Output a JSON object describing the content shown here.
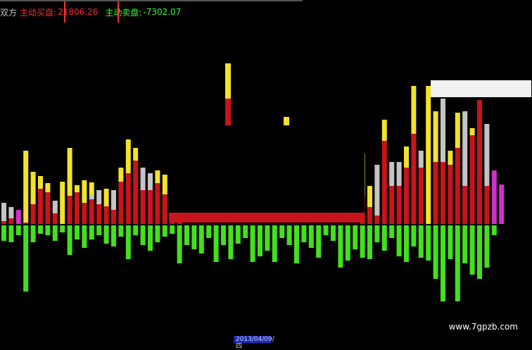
{
  "header": {
    "left_label": "双方",
    "buy_label": "主动买盘:",
    "buy_value": "21806.26",
    "sell_label": "主动卖盘:",
    "sell_value": "-7302.07"
  },
  "watermark": "www.7gpzb.com",
  "date_tag": "2013/04/09/四",
  "colors": {
    "red": "#c8141a",
    "yellow": "#f2e22b",
    "gray": "#c4c4c4",
    "green": "#43e01c",
    "magenta": "#d030c8"
  },
  "chart_data": {
    "type": "bar",
    "baseline": 0,
    "up_bars": [
      {
        "red": 4,
        "yellow": 0,
        "gray": 26
      },
      {
        "red": 8,
        "yellow": 0,
        "gray": 16
      },
      {
        "red": 0,
        "yellow": 0,
        "gray": 0,
        "magenta": 20
      },
      {
        "red": 2,
        "yellow": 102
      },
      {
        "red": 28,
        "yellow": 46
      },
      {
        "red": 50,
        "yellow": 18
      },
      {
        "red": 45,
        "yellow": 13
      },
      {
        "red": 15,
        "yellow": 0,
        "gray": 18
      },
      {
        "red": 0,
        "yellow": 60
      },
      {
        "red": 40,
        "yellow": 68
      },
      {
        "red": 45,
        "yellow": 10
      },
      {
        "red": 30,
        "yellow": 32
      },
      {
        "red": 35,
        "yellow": 18,
        "gray": 6
      },
      {
        "red": 28,
        "yellow": 0,
        "gray": 20
      },
      {
        "red": 25,
        "yellow": 25
      },
      {
        "red": 20,
        "yellow": 0,
        "gray": 28
      },
      {
        "red": 60,
        "yellow": 20,
        "gray": 0
      },
      {
        "red": 72,
        "yellow": 48
      },
      {
        "red": 90,
        "yellow": 18
      },
      {
        "red": 48,
        "yellow": 0,
        "gray": 32
      },
      {
        "red": 48,
        "yellow": 0,
        "gray": 24
      },
      {
        "red": 58,
        "yellow": 18
      },
      {
        "red": 42,
        "yellow": 28
      },
      {
        "red": 90,
        "yellow": 40
      },
      {
        "red": 90,
        "yellow": 40
      },
      {
        "red": 0,
        "yellow": 0
      },
      {
        "red": 0,
        "yellow": 0
      },
      {
        "red": 0,
        "yellow": 0
      },
      {
        "red": 0,
        "yellow": 0
      },
      {
        "red": 0,
        "yellow": 0
      },
      {
        "red": 0,
        "yellow": 0
      },
      {
        "red": 0,
        "yellow": 0
      },
      {
        "red": 0,
        "yellow": 0
      },
      {
        "red": 0,
        "yellow": 0
      },
      {
        "red": 0,
        "yellow": 0
      },
      {
        "red": 0,
        "yellow": 0
      },
      {
        "red": 0,
        "yellow": 0
      },
      {
        "red": 0,
        "yellow": 0
      },
      {
        "red": 0,
        "yellow": 0
      },
      {
        "red": 0,
        "yellow": 0
      },
      {
        "red": 0,
        "yellow": 0
      },
      {
        "red": 0,
        "yellow": 0
      },
      {
        "red": 0,
        "yellow": 0
      },
      {
        "red": 0,
        "yellow": 0
      },
      {
        "red": 0,
        "yellow": 0
      },
      {
        "red": 0,
        "yellow": 0
      },
      {
        "red": 0,
        "yellow": 0
      },
      {
        "red": 0,
        "yellow": 0
      },
      {
        "red": 0,
        "yellow": 0
      },
      {
        "red": 40,
        "yellow": 60
      },
      {
        "red": 24,
        "yellow": 30
      },
      {
        "red": 12,
        "yellow": 0,
        "gray": 72
      },
      {
        "red": 118,
        "yellow": 30
      },
      {
        "red": 54,
        "yellow": 0,
        "gray": 34
      },
      {
        "red": 54,
        "yellow": 0,
        "gray": 34
      },
      {
        "red": 80,
        "yellow": 30
      },
      {
        "red": 128,
        "yellow": 68
      },
      {
        "red": 80,
        "yellow": 0,
        "gray": 24
      },
      {
        "red": 0,
        "yellow": 196
      },
      {
        "red": 88,
        "yellow": 72
      },
      {
        "red": 88,
        "yellow": 0,
        "gray": 90
      },
      {
        "red": 84,
        "yellow": 20,
        "gray": 0
      },
      {
        "red": 108,
        "yellow": 50
      },
      {
        "red": 54,
        "yellow": 0,
        "gray": 106
      },
      {
        "red": 126,
        "yellow": 10
      },
      {
        "red": 176,
        "yellow": 0
      },
      {
        "red": 54,
        "yellow": 0,
        "gray": 88
      },
      {
        "red": 0,
        "yellow": 0,
        "magenta": 76
      },
      {
        "red": 0,
        "yellow": 0,
        "magenta": 56
      }
    ],
    "down_bars": [
      22,
      24,
      14,
      94,
      24,
      12,
      14,
      22,
      10,
      42,
      20,
      32,
      20,
      14,
      26,
      30,
      16,
      48,
      14,
      28,
      36,
      24,
      16,
      12,
      54,
      28,
      34,
      40,
      18,
      52,
      28,
      48,
      26,
      18,
      52,
      44,
      36,
      52,
      18,
      28,
      54,
      24,
      32,
      46,
      14,
      22,
      60,
      50,
      34,
      46,
      48,
      24,
      36,
      18,
      44,
      52,
      30,
      46,
      50,
      76,
      108,
      48,
      108,
      54,
      70,
      76,
      60,
      14
    ]
  }
}
